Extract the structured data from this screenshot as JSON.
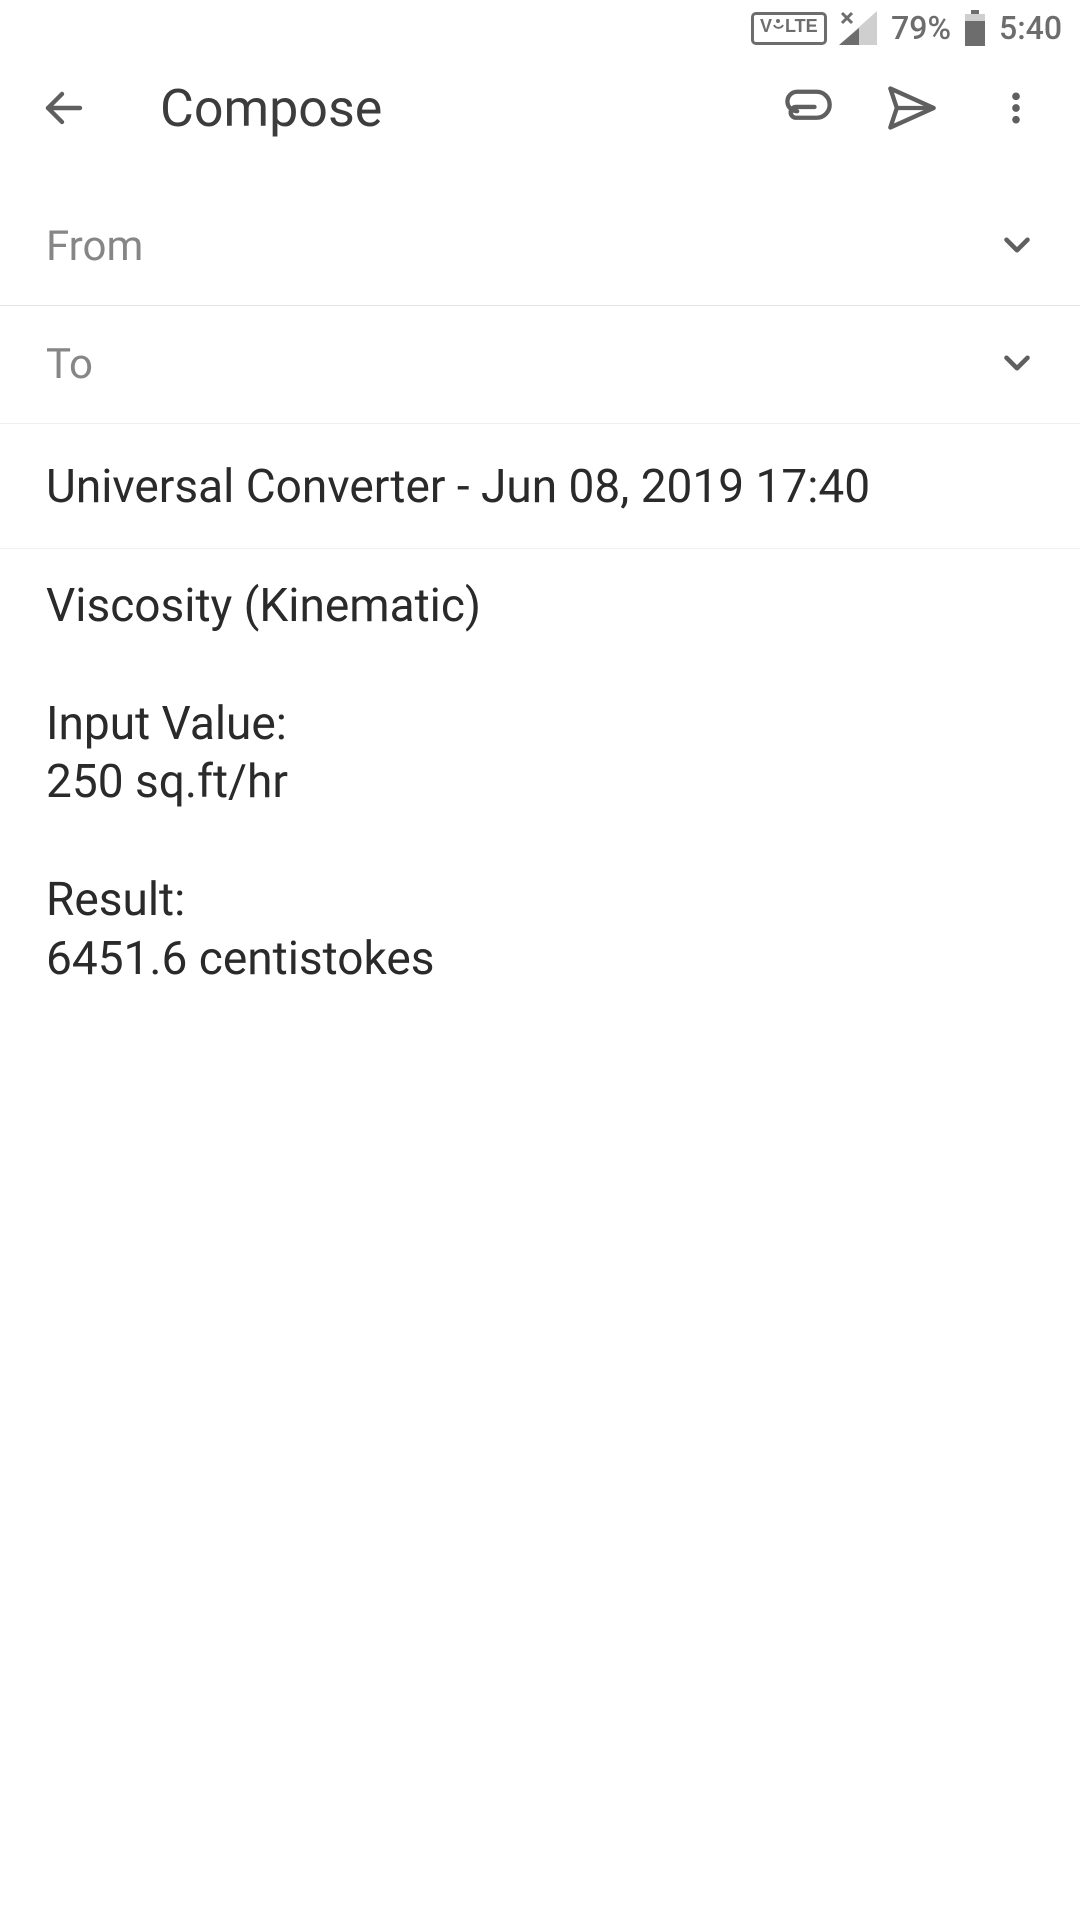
{
  "status": {
    "volte": "V LTE",
    "battery": "79%",
    "time": "5:40"
  },
  "toolbar": {
    "title": "Compose"
  },
  "fields": {
    "from_label": "From",
    "to_label": "To"
  },
  "subject": "Universal Converter - Jun 08, 2019 17:40",
  "body": "Viscosity (Kinematic)\n\nInput Value:\n250 sq.ft/hr\n\nResult:\n6451.6 centistokes"
}
